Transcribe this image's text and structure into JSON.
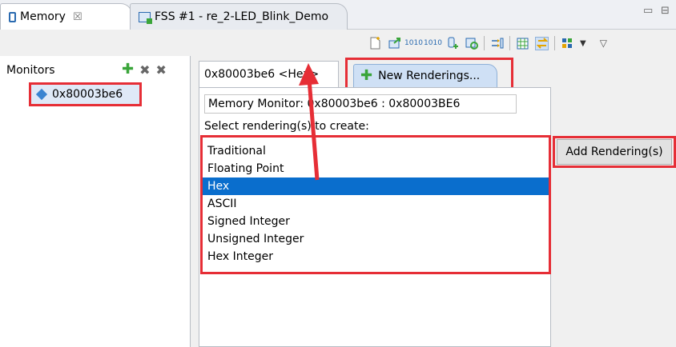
{
  "tabs": {
    "memory": {
      "label": "Memory",
      "close": "☒"
    },
    "fss": {
      "label": "FSS #1 - re_2-LED_Blink_Demo"
    }
  },
  "window_controls": {
    "minimize": "▭",
    "maximize": "⊟"
  },
  "toolbar": {
    "icons": [
      "new-icon",
      "import-icon",
      "export-icon",
      "binary-icon",
      "add-memory-icon",
      "refresh-icon",
      "layout-icon",
      "grid-icon",
      "toggle-icon",
      "view-menu-icon"
    ]
  },
  "monitors": {
    "title": "Monitors",
    "items": [
      {
        "label": "0x80003be6"
      }
    ]
  },
  "rendering": {
    "tab_label": "0x80003be6 <Hex>",
    "new_tab_label": "New Renderings...",
    "monitor_label": "Memory Monitor: 0x80003be6 : 0x80003BE6",
    "select_label": "Select rendering(s) to create:",
    "options": [
      "Traditional",
      "Floating Point",
      "Hex",
      "ASCII",
      "Signed Integer",
      "Unsigned Integer",
      "Hex Integer"
    ],
    "selected": "Hex",
    "add_button": "Add Rendering(s)"
  },
  "colors": {
    "highlight_red": "#e62e36",
    "selection_blue": "#0a6ecd",
    "add_green": "#3aa53a"
  }
}
